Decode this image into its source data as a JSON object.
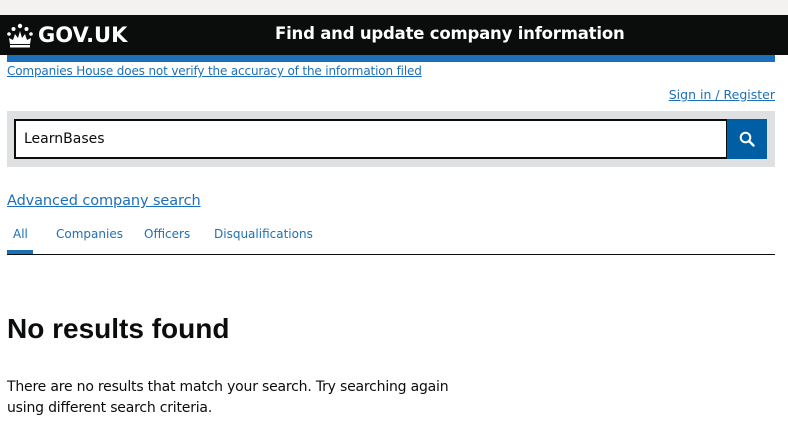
{
  "header": {
    "logo_text": "GOV.UK",
    "service_name": "Find and update company information"
  },
  "disclaimer": "Companies House does not verify the accuracy of the information filed",
  "signin_label": "Sign in / Register",
  "search": {
    "value": "LearnBases",
    "button_icon": "search-icon"
  },
  "advanced_search_label": "Advanced company search",
  "tabs": [
    {
      "label": "All",
      "active": true
    },
    {
      "label": "Companies",
      "active": false
    },
    {
      "label": "Officers",
      "active": false
    },
    {
      "label": "Disqualifications",
      "active": false
    }
  ],
  "results": {
    "heading": "No results found",
    "message": "There are no results that match your search. Try searching again using different search criteria."
  },
  "colors": {
    "link": "#1d70b8",
    "header_bg": "#0b0c0c",
    "search_button": "#005ea5",
    "panel": "#dee0e2"
  }
}
